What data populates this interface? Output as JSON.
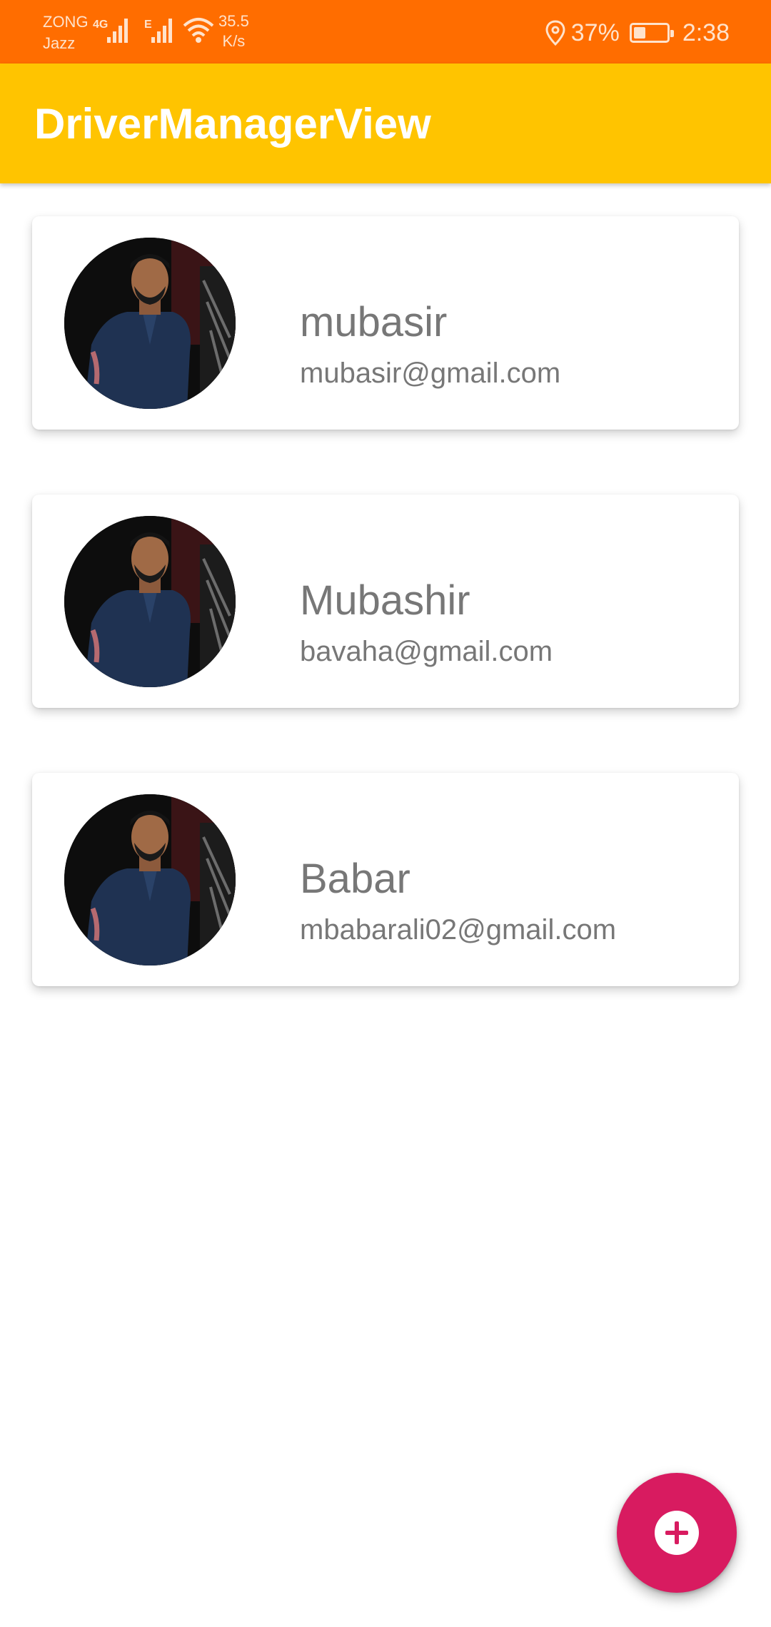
{
  "status_bar": {
    "carrier_primary": "ZONG",
    "carrier_secondary": "Jazz",
    "network_primary": "4G",
    "network_secondary": "E",
    "speed_value": "35.5",
    "speed_unit": "K/s",
    "battery_percent": "37%",
    "battery_level": 0.37,
    "time": "2:38",
    "color": "#ff6d00"
  },
  "app_bar": {
    "title": "DriverManagerView",
    "color": "#ffc400"
  },
  "drivers": [
    {
      "name": "mubasir",
      "email": "mubasir@gmail.com"
    },
    {
      "name": "Mubashir",
      "email": "bavaha@gmail.com"
    },
    {
      "name": "Babar",
      "email": "mbabarali02@gmail.com"
    }
  ],
  "fab": {
    "icon": "add-circle-icon",
    "color": "#d81b60"
  }
}
